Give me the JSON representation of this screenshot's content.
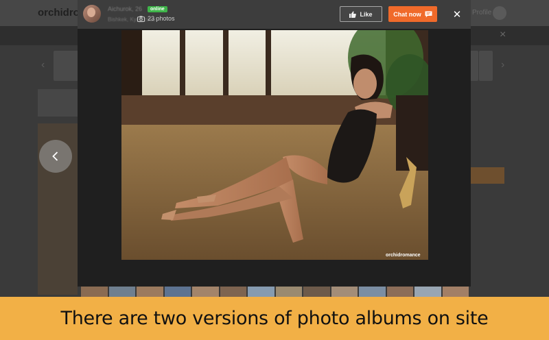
{
  "background_site": {
    "logo": "orchidromance",
    "profile_label": "Profile",
    "close_symbol": "×",
    "prev_symbol": "‹",
    "next_symbol": "›"
  },
  "modal": {
    "user": {
      "name": "Aichurok, 26",
      "status": "online",
      "city": "Bishkek, Kyrgyzstan",
      "photos_count": "23 photos",
      "photos_icon": "camera-icon"
    },
    "like_button": {
      "label": "Like",
      "icon": "thumbs-up-icon"
    },
    "chat_button": {
      "label": "Chat now",
      "icon": "chat-bubble-icon"
    },
    "close_button": {
      "symbol": "✕"
    },
    "photo": {
      "watermark": "orchidromance"
    },
    "prev_button": {
      "icon": "chevron-left-icon"
    },
    "thumbnail_count": 14
  },
  "caption": "There are two versions of photo albums on site",
  "colors": {
    "accent_orange": "#f06a2a",
    "online_green": "#3fb54a",
    "caption_bg": "#f2b046"
  }
}
